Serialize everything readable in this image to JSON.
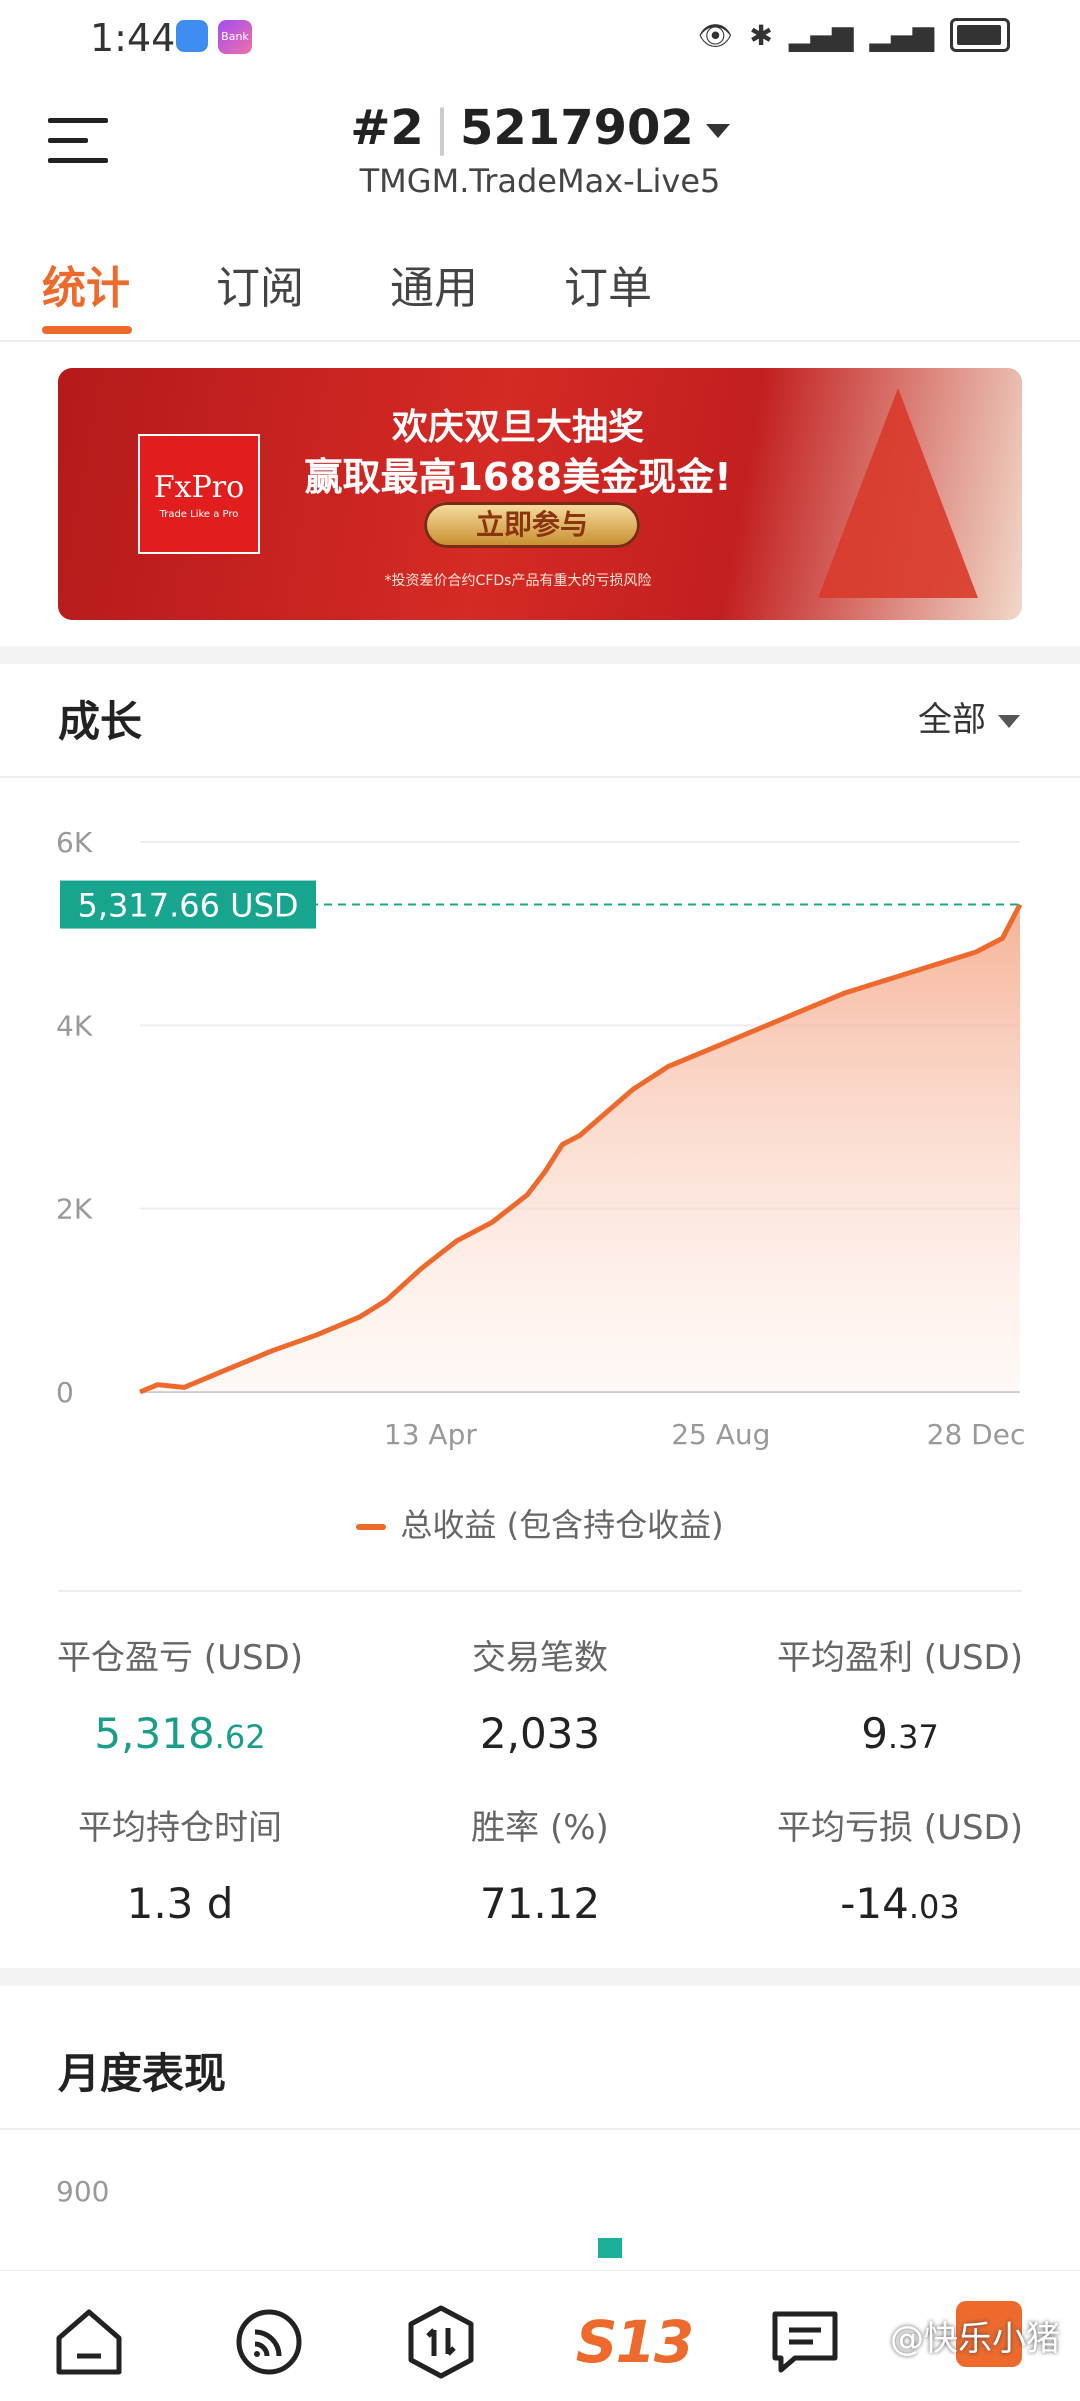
{
  "status": {
    "time": "1:44",
    "app2": "Bank"
  },
  "header": {
    "account_prefix": "#2",
    "account_number": "5217902",
    "server": "TMGM.TradeMax-Live5"
  },
  "tabs": [
    {
      "label": "统计",
      "active": true
    },
    {
      "label": "订阅",
      "active": false
    },
    {
      "label": "通用",
      "active": false
    },
    {
      "label": "订单",
      "active": false
    }
  ],
  "banner": {
    "logo_text": "FxPro",
    "logo_tagline": "Trade Like a Pro",
    "headline": "欢庆双旦大抽奖",
    "subheadline": "赢取最高1688美金现金!",
    "cta": "立即参与",
    "risk_note": "*投资差价合约CFDs产品有重大的亏损风险"
  },
  "growth": {
    "title": "成长",
    "range": "全部"
  },
  "chart_data": {
    "type": "area",
    "y_ticks": [
      "6K",
      "4K",
      "2K",
      "0"
    ],
    "x_ticks": [
      "13 Apr",
      "25 Aug",
      "28 Dec"
    ],
    "ylim": [
      0,
      6000
    ],
    "current_value_label": "5,317.66 USD",
    "current_value": 5317.66,
    "series": [
      {
        "name": "总收益 (包含持仓收益)",
        "color": "#ee6a2c",
        "x": [
          0,
          0.02,
          0.05,
          0.1,
          0.15,
          0.2,
          0.25,
          0.28,
          0.32,
          0.36,
          0.4,
          0.44,
          0.46,
          0.48,
          0.5,
          0.53,
          0.56,
          0.6,
          0.65,
          0.7,
          0.75,
          0.8,
          0.85,
          0.9,
          0.95,
          0.98,
          1.0
        ],
        "values": [
          0,
          80,
          50,
          250,
          450,
          620,
          820,
          1000,
          1350,
          1650,
          1850,
          2150,
          2400,
          2700,
          2800,
          3050,
          3300,
          3550,
          3750,
          3950,
          4150,
          4350,
          4500,
          4650,
          4800,
          4950,
          5317
        ]
      }
    ]
  },
  "stats": [
    {
      "label": "平仓盈亏 (USD)",
      "main": "5,318",
      "decimal": ".62",
      "color": "green"
    },
    {
      "label": "交易笔数",
      "main": "2,033",
      "decimal": ""
    },
    {
      "label": "平均盈利 (USD)",
      "main": "9",
      "decimal": ".37"
    },
    {
      "label": "平均持仓时间",
      "main": "1.3 d",
      "decimal": ""
    },
    {
      "label": "胜率 (%)",
      "main": "71.12",
      "decimal": ""
    },
    {
      "label": "平均亏损 (USD)",
      "main": "-14",
      "decimal": ".03"
    }
  ],
  "monthly": {
    "title": "月度表现",
    "axis_top": "900"
  },
  "nav": {
    "brand": "S13",
    "watermark": "@快乐小猪"
  }
}
